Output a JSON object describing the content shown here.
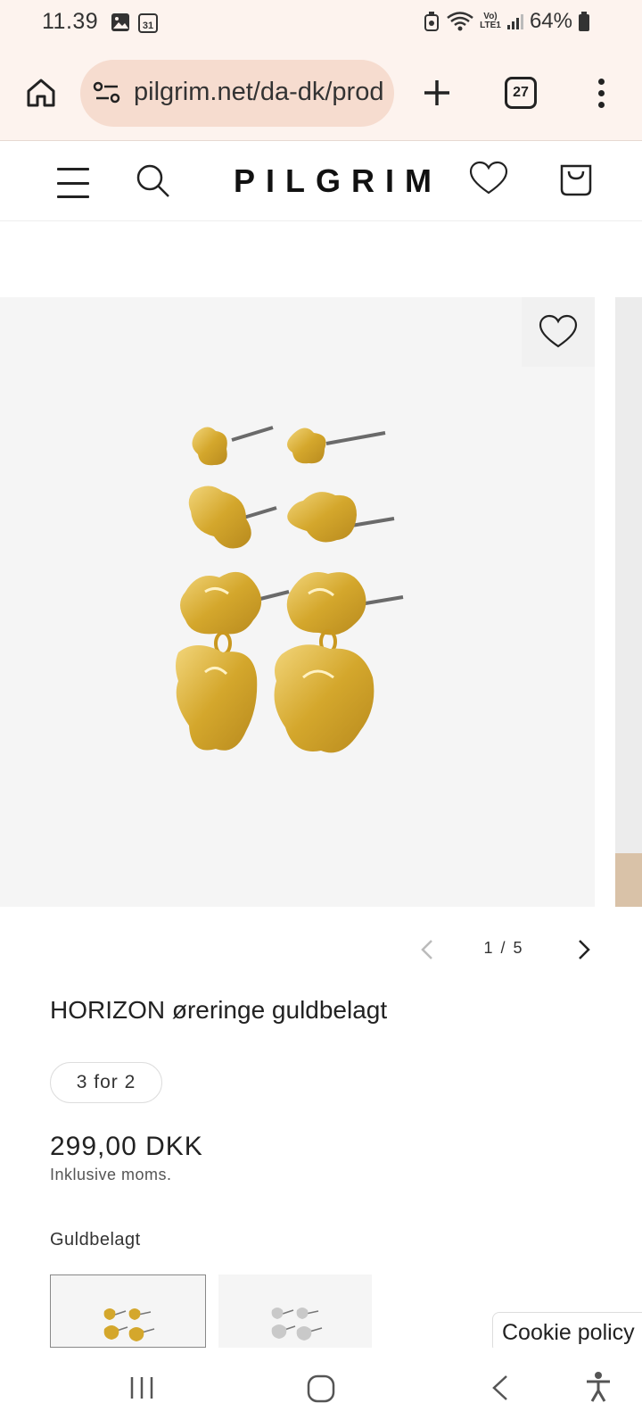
{
  "status_bar": {
    "time": "11.39",
    "calendar_day": "31",
    "network": "Vo) LTE1",
    "battery": "64%"
  },
  "browser": {
    "url": "pilgrim.net/da-dk/products/horizon",
    "tab_count": "27"
  },
  "site": {
    "brand": "PILGRIM"
  },
  "gallery": {
    "counter": "1 / 5"
  },
  "product": {
    "title": "HORIZON øreringe guldbelagt",
    "promo": "3 for 2",
    "price": "299,00 DKK",
    "tax_note": "Inklusive moms.",
    "variant_label": "Guldbelagt"
  },
  "cookie": {
    "label": "Cookie policy"
  },
  "colors": {
    "browser_bg": "#fdf3ee",
    "url_pill": "#f6dccf",
    "gold": "#d4a72c",
    "silver": "#c9c9c9"
  }
}
